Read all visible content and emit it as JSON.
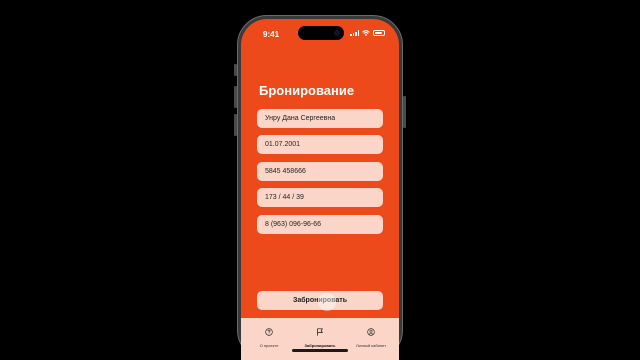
{
  "status_bar": {
    "time": "9:41"
  },
  "page": {
    "title": "Бронирование"
  },
  "form": {
    "fields": [
      {
        "value": "Унру Дана Сергеевна"
      },
      {
        "value": "01.07.2001"
      },
      {
        "value": "5845 458666"
      },
      {
        "value": "173 / 44 / 39"
      },
      {
        "value": "8 (963) 096-96-66"
      }
    ],
    "submit_label": "Забронировать"
  },
  "tabbar": {
    "items": [
      {
        "label": "О проекте",
        "icon": "question-circle-icon",
        "active": false
      },
      {
        "label": "Забронировать",
        "icon": "flag-icon",
        "active": true
      },
      {
        "label": "Личный кабинет",
        "icon": "person-circle-icon",
        "active": false
      }
    ]
  },
  "colors": {
    "accent": "#ec4a1a",
    "field_bg": "#fbd6c8",
    "frame": "#3a3a3c"
  }
}
